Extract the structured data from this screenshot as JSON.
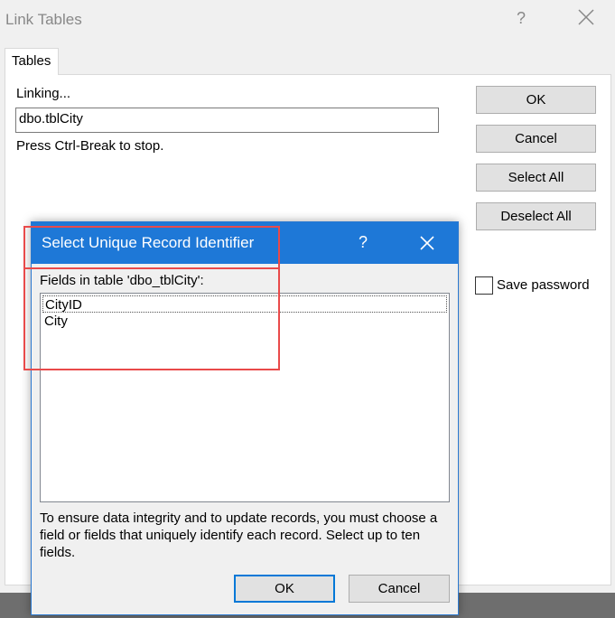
{
  "outer": {
    "title": "Link Tables",
    "help": "?",
    "tab": "Tables",
    "linking_label": "Linking...",
    "table_name": "dbo.tblCity",
    "hint": "Press Ctrl-Break to stop.",
    "buttons": {
      "ok": "OK",
      "cancel": "Cancel",
      "select_all": "Select All",
      "deselect_all": "Deselect All"
    },
    "save_password_label": "Save password",
    "save_password_checked": false
  },
  "dialog": {
    "title": "Select Unique Record Identifier",
    "help": "?",
    "fields_label": "Fields in table 'dbo_tblCity':",
    "fields": [
      "CityID",
      "City"
    ],
    "info": "To ensure data integrity and to update records, you must choose a field or fields that uniquely identify each record. Select up to ten fields.",
    "buttons": {
      "ok": "OK",
      "cancel": "Cancel"
    }
  },
  "colors": {
    "title_bar": "#1e78d7",
    "highlight": "#e94a4a"
  }
}
